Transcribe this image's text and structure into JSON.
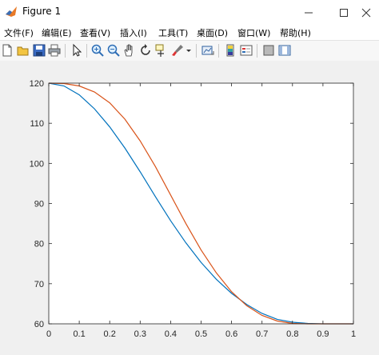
{
  "window": {
    "title": "Figure 1"
  },
  "menu": [
    {
      "label": "文件(F)"
    },
    {
      "label": "编辑(E)"
    },
    {
      "label": "查看(V)"
    },
    {
      "label": "插入(I)"
    },
    {
      "label": "工具(T)"
    },
    {
      "label": "桌面(D)"
    },
    {
      "label": "窗口(W)"
    },
    {
      "label": "帮助(H)"
    }
  ],
  "toolbar": {
    "icons": [
      "new-figure-icon",
      "open-file-icon",
      "save-icon",
      "print-icon",
      "pointer-icon",
      "zoom-in-icon",
      "zoom-out-icon",
      "pan-icon",
      "rotate-3d-icon",
      "data-cursor-icon",
      "brush-icon",
      "brush-dropdown-icon",
      "link-plot-icon",
      "colorbar-icon",
      "legend-icon",
      "hide-plot-tools-icon",
      "show-plot-tools-icon"
    ]
  },
  "colors": {
    "series1": "#0072BD",
    "series2": "#D95319"
  },
  "chart_data": {
    "type": "line",
    "title": "",
    "xlabel": "",
    "ylabel": "",
    "xlim": [
      0,
      1
    ],
    "ylim": [
      60,
      120
    ],
    "grid": false,
    "xticks": [
      "0",
      "0.1",
      "0.2",
      "0.3",
      "0.4",
      "0.5",
      "0.6",
      "0.7",
      "0.8",
      "0.9",
      "1"
    ],
    "yticks": [
      "60",
      "70",
      "80",
      "90",
      "100",
      "110",
      "120"
    ],
    "x": [
      0,
      0.05,
      0.1,
      0.15,
      0.2,
      0.25,
      0.3,
      0.35,
      0.4,
      0.45,
      0.5,
      0.55,
      0.6,
      0.65,
      0.7,
      0.75,
      0.8,
      0.85,
      0.9,
      0.95,
      1
    ],
    "series": [
      {
        "values": [
          120,
          119.3,
          117.1,
          113.6,
          109.1,
          103.8,
          97.9,
          91.7,
          85.7,
          80.2,
          75.3,
          71.1,
          67.6,
          64.8,
          62.6,
          61.1,
          60.4,
          60.1,
          60,
          60,
          60
        ]
      },
      {
        "values": [
          120,
          119.9,
          119.3,
          117.8,
          115.1,
          111.0,
          105.6,
          99.2,
          92.1,
          85.0,
          78.4,
          72.7,
          68.0,
          64.5,
          62.1,
          60.7,
          60.1,
          60,
          60,
          60,
          60
        ]
      }
    ]
  }
}
